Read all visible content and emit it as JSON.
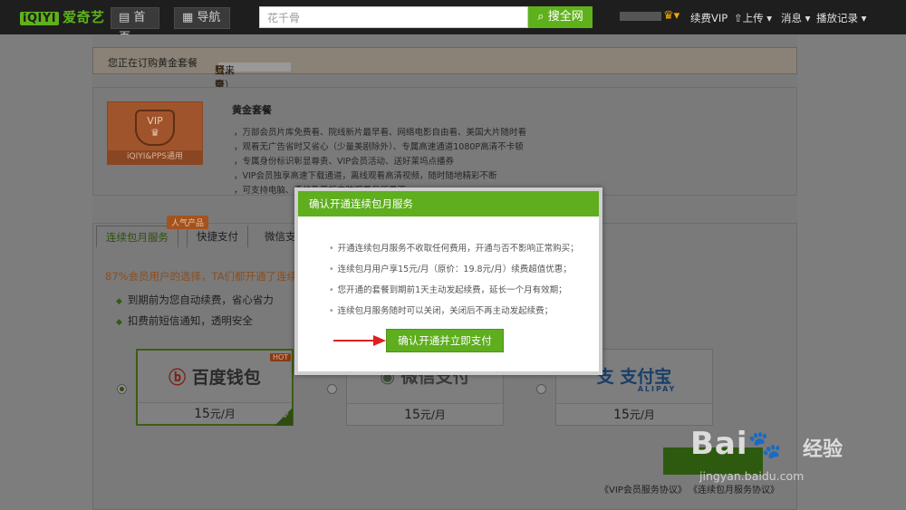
{
  "topbar": {
    "logo_mark": "iQIYI",
    "logo_text": "爱奇艺",
    "home": "首页",
    "nav": "导航",
    "search_value": "花千骨",
    "search_button": "搜全网",
    "links": [
      "续费VIP",
      "上传",
      "消息",
      "播放记录"
    ]
  },
  "order": {
    "subscribing": "您正在订购黄金套餐",
    "account_label": "当前账号：",
    "source_prefix": "（来自",
    "source_name": "腾讯QQ",
    "source_suffix": "登录）"
  },
  "package": {
    "card_badge": "VIP",
    "card_label": "iQIYI&PPS通用",
    "title": "黄金套餐",
    "benefits": [
      "，万部会员片库免费看、院线新片最早看、网络电影自由看、美国大片随时看",
      "，观看无广告省时又省心（少量美剧除外）、专属高速通道1080P高清不卡顿",
      "，专属身份标识彰显尊贵、VIP会员活动、送好莱坞点播券",
      "，VIP会员独享高速下载通道，离线观看高清视频，随时随地精彩不断",
      "，可支持电脑、手机及平板电脑观看且所看不…"
    ]
  },
  "tabs": {
    "hot": "人气产品",
    "items": [
      "连续包月服务",
      "快捷支付",
      "微信支"
    ]
  },
  "promo": "87%会员用户的选择，TA们都开通了连续",
  "bullets": [
    "到期前为您自动续费，省心省力",
    "扣费前短信通知，透明安全"
  ],
  "payments": [
    {
      "name": "百度钱包",
      "price": "15",
      "unit": "元/月",
      "hot": "HOT",
      "color": "#8a2a1a"
    },
    {
      "name": "微信支付",
      "price": "15",
      "unit": "元/月",
      "color": "#3a5a2a"
    },
    {
      "name": "支付宝",
      "price": "15",
      "unit": "元/月",
      "sub": "ALIPAY",
      "color": "#1a4a8a"
    }
  ],
  "agreements": [
    "《VIP会员服务协议》",
    "《连续包月服务协议》"
  ],
  "dialog": {
    "title": "确认开通连续包月服务",
    "items": [
      "开通连续包月服务不收取任何费用，开通与否不影响正常购买；",
      "连续包月用户享15元/月（原价：19.8元/月）续费超值优惠；",
      "您开通的套餐到期前1天主动发起续费，延长一个月有效期；",
      "连续包月服务随时可以关闭，关闭后不再主动发起续费；"
    ],
    "button": "确认开通并立即支付"
  },
  "watermark": {
    "logo": "Bai",
    "logo_tail": "经验",
    "url": "jingyan.baidu.com"
  }
}
